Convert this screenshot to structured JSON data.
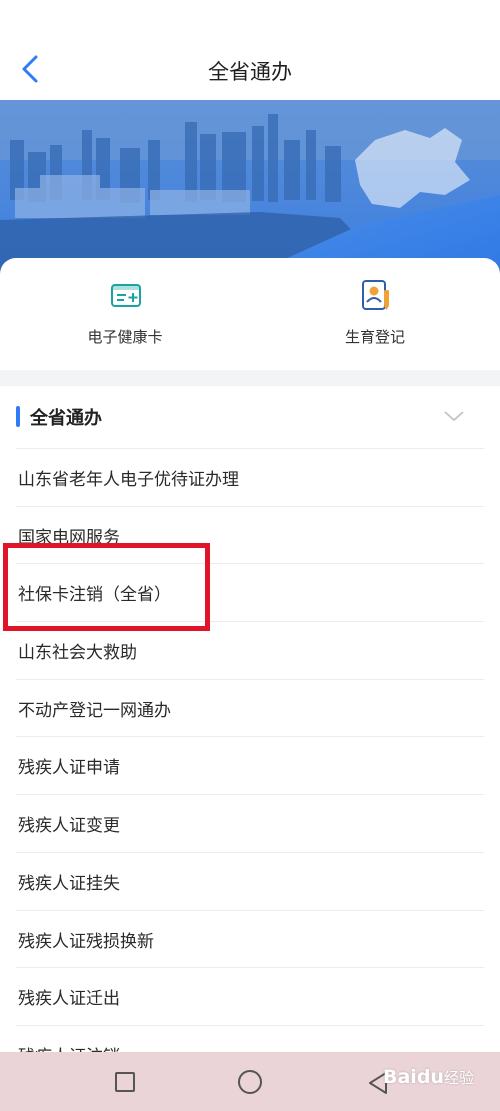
{
  "header": {
    "title": "全省通办"
  },
  "shortcuts": [
    {
      "label": "电子健康卡",
      "icon": "health-card-icon"
    },
    {
      "label": "生育登记",
      "icon": "birth-registration-icon"
    }
  ],
  "section": {
    "title": "全省通办"
  },
  "services": [
    "山东省老年人电子优待证办理",
    "国家电网服务",
    "社保卡注销（全省）",
    "山东社会大救助",
    "不动产登记一网通办",
    "残疾人证申请",
    "残疾人证变更",
    "残疾人证挂失",
    "残疾人证残损换新",
    "残疾人证迁出",
    "残疾人证注销"
  ],
  "watermark": {
    "brand": "Baidu",
    "sub": "经验"
  },
  "colors": {
    "accent": "#2f7cf6",
    "highlight": "#e0152a",
    "navbar": "#ead4d8"
  }
}
